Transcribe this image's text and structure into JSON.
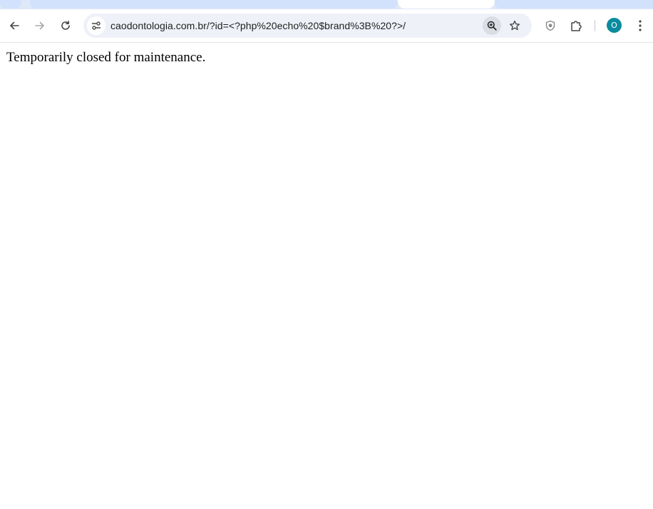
{
  "browser": {
    "url": "caodontologia.com.br/?id=<?php%20echo%20$brand%3B%20?>/",
    "profile_initial": "O",
    "icons": {
      "back": "arrow-left-icon",
      "forward": "arrow-right-icon",
      "reload": "reload-icon",
      "site_info": "tune-icon",
      "zoom": "zoom-in-icon",
      "bookmark": "star-icon",
      "extension_shield": "shield-icon",
      "extensions": "puzzle-icon",
      "menu": "kebab-menu-icon"
    },
    "colors": {
      "avatar": "#0a8c9e",
      "omnibox": "#eef1f8",
      "tabstrip": "#dfe8f6"
    }
  },
  "page": {
    "message": "Temporarily closed for maintenance."
  }
}
